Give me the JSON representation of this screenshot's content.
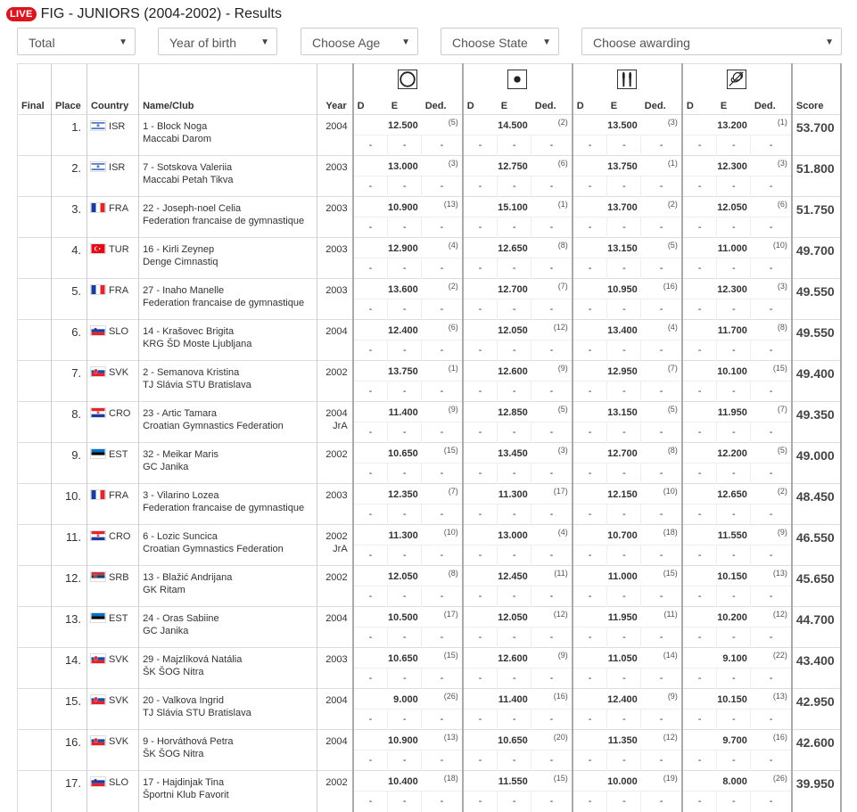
{
  "header": {
    "live_badge": "LIVE",
    "title": "FIG - JUNIORS (2004-2002) - Results"
  },
  "filters": [
    {
      "label": "Total"
    },
    {
      "label": "Year of birth"
    },
    {
      "label": "Choose Age"
    },
    {
      "label": "Choose State"
    },
    {
      "label": "Choose awarding"
    }
  ],
  "columns": {
    "final": "Final",
    "place": "Place",
    "country": "Country",
    "name": "Name/Club",
    "year": "Year",
    "d": "D",
    "e": "E",
    "ded": "Ded.",
    "score": "Score"
  },
  "apparatus": [
    "hoop-icon",
    "ball-icon",
    "clubs-icon",
    "ribbon-icon"
  ],
  "dash": "-",
  "rows": [
    {
      "place": "1.",
      "flag": "ISR",
      "country": "ISR",
      "name": "1 - Block Noga",
      "club": "Maccabi Darom",
      "year": "2004",
      "yr2": "",
      "scores": [
        [
          "12.500",
          "(5)"
        ],
        [
          "14.500",
          "(2)"
        ],
        [
          "13.500",
          "(3)"
        ],
        [
          "13.200",
          "(1)"
        ]
      ],
      "total": "53.700"
    },
    {
      "place": "2.",
      "flag": "ISR",
      "country": "ISR",
      "name": "7 - Sotskova Valeriia",
      "club": "Maccabi Petah Tikva",
      "year": "2003",
      "yr2": "",
      "scores": [
        [
          "13.000",
          "(3)"
        ],
        [
          "12.750",
          "(6)"
        ],
        [
          "13.750",
          "(1)"
        ],
        [
          "12.300",
          "(3)"
        ]
      ],
      "total": "51.800"
    },
    {
      "place": "3.",
      "flag": "FRA",
      "country": "FRA",
      "name": "22 - Joseph-noel Celia",
      "club": "Federation francaise de gymnastique",
      "year": "2003",
      "yr2": "",
      "scores": [
        [
          "10.900",
          "(13)"
        ],
        [
          "15.100",
          "(1)"
        ],
        [
          "13.700",
          "(2)"
        ],
        [
          "12.050",
          "(6)"
        ]
      ],
      "total": "51.750"
    },
    {
      "place": "4.",
      "flag": "TUR",
      "country": "TUR",
      "name": "16 - Kirli Zeynep",
      "club": "Denge Cimnastiq",
      "year": "2003",
      "yr2": "",
      "scores": [
        [
          "12.900",
          "(4)"
        ],
        [
          "12.650",
          "(8)"
        ],
        [
          "13.150",
          "(5)"
        ],
        [
          "11.000",
          "(10)"
        ]
      ],
      "total": "49.700"
    },
    {
      "place": "5.",
      "flag": "FRA",
      "country": "FRA",
      "name": "27 - Inaho Manelle",
      "club": "Federation francaise de gymnastique",
      "year": "2003",
      "yr2": "",
      "scores": [
        [
          "13.600",
          "(2)"
        ],
        [
          "12.700",
          "(7)"
        ],
        [
          "10.950",
          "(16)"
        ],
        [
          "12.300",
          "(3)"
        ]
      ],
      "total": "49.550"
    },
    {
      "place": "6.",
      "flag": "SLO",
      "country": "SLO",
      "name": "14 - Krašovec Brigita",
      "club": "KRG ŠD Moste Ljubljana",
      "year": "2004",
      "yr2": "",
      "scores": [
        [
          "12.400",
          "(6)"
        ],
        [
          "12.050",
          "(12)"
        ],
        [
          "13.400",
          "(4)"
        ],
        [
          "11.700",
          "(8)"
        ]
      ],
      "total": "49.550"
    },
    {
      "place": "7.",
      "flag": "SVK",
      "country": "SVK",
      "name": "2 - Semanova Kristina",
      "club": "TJ Slávia STU Bratislava",
      "year": "2002",
      "yr2": "",
      "scores": [
        [
          "13.750",
          "(1)"
        ],
        [
          "12.600",
          "(9)"
        ],
        [
          "12.950",
          "(7)"
        ],
        [
          "10.100",
          "(15)"
        ]
      ],
      "total": "49.400"
    },
    {
      "place": "8.",
      "flag": "CRO",
      "country": "CRO",
      "name": "23 - Artic Tamara",
      "club": "Croatian Gymnastics Federation",
      "year": "2004",
      "yr2": "JrA",
      "scores": [
        [
          "11.400",
          "(9)"
        ],
        [
          "12.850",
          "(5)"
        ],
        [
          "13.150",
          "(5)"
        ],
        [
          "11.950",
          "(7)"
        ]
      ],
      "total": "49.350"
    },
    {
      "place": "9.",
      "flag": "EST",
      "country": "EST",
      "name": "32 - Meikar Maris",
      "club": "GC Janika",
      "year": "2002",
      "yr2": "",
      "scores": [
        [
          "10.650",
          "(15)"
        ],
        [
          "13.450",
          "(3)"
        ],
        [
          "12.700",
          "(8)"
        ],
        [
          "12.200",
          "(5)"
        ]
      ],
      "total": "49.000"
    },
    {
      "place": "10.",
      "flag": "FRA",
      "country": "FRA",
      "name": "3 - Vilarino Lozea",
      "club": "Federation francaise de gymnastique",
      "year": "2003",
      "yr2": "",
      "scores": [
        [
          "12.350",
          "(7)"
        ],
        [
          "11.300",
          "(17)"
        ],
        [
          "12.150",
          "(10)"
        ],
        [
          "12.650",
          "(2)"
        ]
      ],
      "total": "48.450"
    },
    {
      "place": "11.",
      "flag": "CRO",
      "country": "CRO",
      "name": "6 - Lozic Suncica",
      "club": "Croatian Gymnastics Federation",
      "year": "2002",
      "yr2": "JrA",
      "scores": [
        [
          "11.300",
          "(10)"
        ],
        [
          "13.000",
          "(4)"
        ],
        [
          "10.700",
          "(18)"
        ],
        [
          "11.550",
          "(9)"
        ]
      ],
      "total": "46.550"
    },
    {
      "place": "12.",
      "flag": "SRB",
      "country": "SRB",
      "name": "13 - Blažić Andrijana",
      "club": "GK Ritam",
      "year": "2002",
      "yr2": "",
      "scores": [
        [
          "12.050",
          "(8)"
        ],
        [
          "12.450",
          "(11)"
        ],
        [
          "11.000",
          "(15)"
        ],
        [
          "10.150",
          "(13)"
        ]
      ],
      "total": "45.650"
    },
    {
      "place": "13.",
      "flag": "EST",
      "country": "EST",
      "name": "24 - Oras Sabiine",
      "club": "GC Janika",
      "year": "2004",
      "yr2": "",
      "scores": [
        [
          "10.500",
          "(17)"
        ],
        [
          "12.050",
          "(12)"
        ],
        [
          "11.950",
          "(11)"
        ],
        [
          "10.200",
          "(12)"
        ]
      ],
      "total": "44.700"
    },
    {
      "place": "14.",
      "flag": "SVK",
      "country": "SVK",
      "name": "29 - Majzlíková Natália",
      "club": "ŠK ŠOG Nitra",
      "year": "2003",
      "yr2": "",
      "scores": [
        [
          "10.650",
          "(15)"
        ],
        [
          "12.600",
          "(9)"
        ],
        [
          "11.050",
          "(14)"
        ],
        [
          "9.100",
          "(22)"
        ]
      ],
      "total": "43.400"
    },
    {
      "place": "15.",
      "flag": "SVK",
      "country": "SVK",
      "name": "20 - Valkova Ingrid",
      "club": "TJ Slávia STU Bratislava",
      "year": "2004",
      "yr2": "",
      "scores": [
        [
          "9.000",
          "(26)"
        ],
        [
          "11.400",
          "(16)"
        ],
        [
          "12.400",
          "(9)"
        ],
        [
          "10.150",
          "(13)"
        ]
      ],
      "total": "42.950"
    },
    {
      "place": "16.",
      "flag": "SVK",
      "country": "SVK",
      "name": "9 - Horváthová Petra",
      "club": "ŠK ŠOG Nitra",
      "year": "2004",
      "yr2": "",
      "scores": [
        [
          "10.900",
          "(13)"
        ],
        [
          "10.650",
          "(20)"
        ],
        [
          "11.350",
          "(12)"
        ],
        [
          "9.700",
          "(16)"
        ]
      ],
      "total": "42.600"
    },
    {
      "place": "17.",
      "flag": "SLO",
      "country": "SLO",
      "name": "17 - Hajdinjak Tina",
      "club": "Športni Klub Favorit",
      "year": "2002",
      "yr2": "",
      "scores": [
        [
          "10.400",
          "(18)"
        ],
        [
          "11.550",
          "(15)"
        ],
        [
          "10.000",
          "(19)"
        ],
        [
          "8.000",
          "(26)"
        ]
      ],
      "total": "39.950"
    }
  ]
}
